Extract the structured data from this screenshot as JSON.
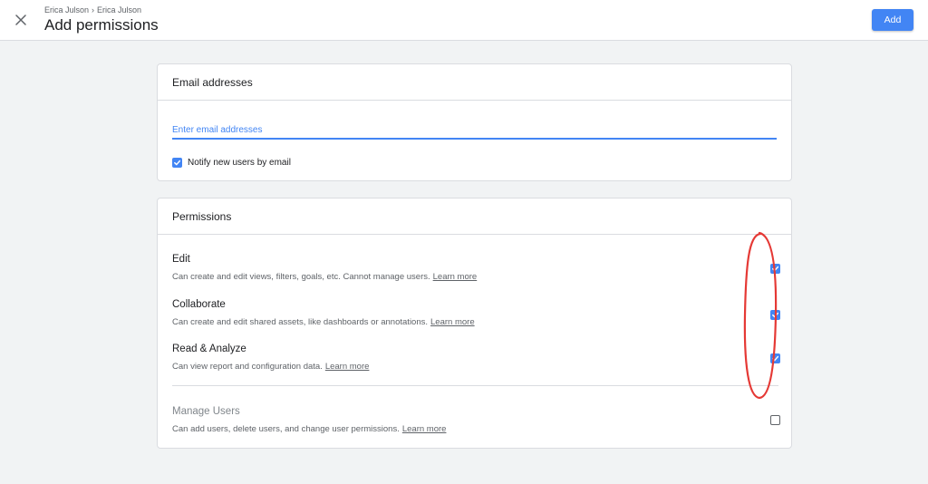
{
  "header": {
    "breadcrumb": [
      "Erica Julson",
      "Erica Julson"
    ],
    "breadcrumb_separator": "›",
    "title": "Add permissions",
    "add_label": "Add"
  },
  "email_card": {
    "title": "Email addresses",
    "input_placeholder": "Enter email addresses",
    "input_value": "",
    "notify_label": "Notify new users by email",
    "notify_checked": true
  },
  "permissions_card": {
    "title": "Permissions",
    "items": [
      {
        "title": "Edit",
        "description": "Can create and edit views, filters, goals, etc. Cannot manage users.",
        "link": "Learn more",
        "checked": true
      },
      {
        "title": "Collaborate",
        "description": "Can create and edit shared assets, like dashboards or annotations.",
        "link": "Learn more",
        "checked": true
      },
      {
        "title": "Read & Analyze",
        "description": "Can view report and configuration data.",
        "link": "Learn more",
        "checked": true
      },
      {
        "title": "Manage Users",
        "description": "Can add users, delete users, and change user permissions.",
        "link": "Learn more",
        "checked": false
      }
    ]
  },
  "colors": {
    "accent": "#4285f4",
    "annotation": "#e53935",
    "background": "#f1f3f4"
  },
  "icons": {
    "close": "close-icon",
    "check": "checkmark-icon"
  }
}
